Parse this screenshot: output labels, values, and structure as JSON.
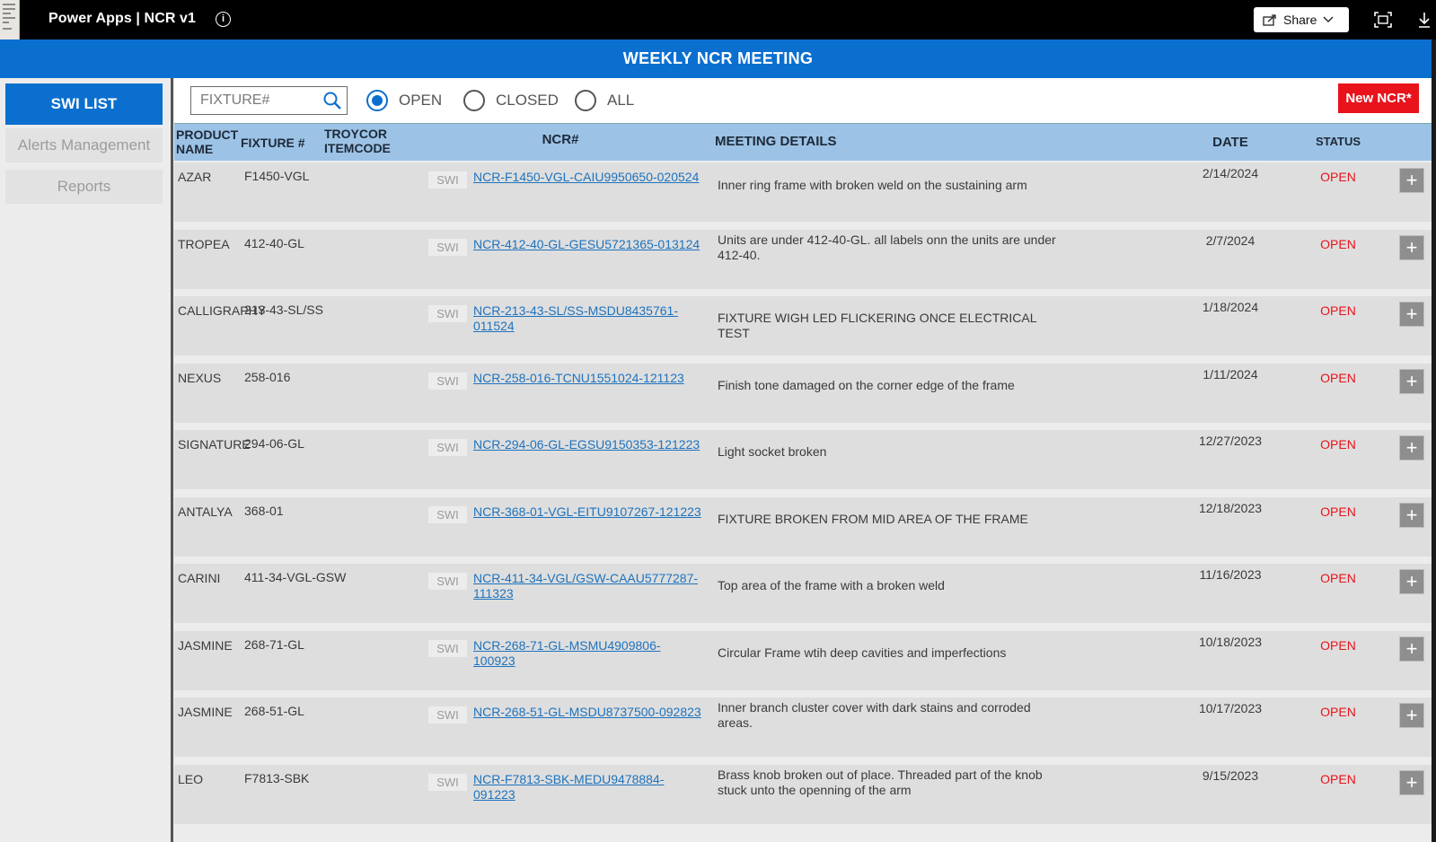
{
  "app": {
    "title": "Power Apps  |  NCR v1",
    "share_label": "Share"
  },
  "header": {
    "title": "WEEKLY NCR MEETING"
  },
  "sidebar": {
    "items": [
      {
        "label": "SWI LIST",
        "active": true
      },
      {
        "label": "Alerts Management",
        "active": false
      },
      {
        "label": "Reports",
        "active": false
      }
    ]
  },
  "filter": {
    "search_placeholder": "FIXTURE#",
    "options": [
      {
        "label": "OPEN",
        "selected": true
      },
      {
        "label": "CLOSED",
        "selected": false
      },
      {
        "label": "ALL",
        "selected": false
      }
    ],
    "new_button_label": "New NCR*"
  },
  "table": {
    "columns": {
      "product_line1": "PRODUCT",
      "product_line2": "NAME",
      "fixture": "FIXTURE #",
      "troycor_line1": "TROYCOR",
      "troycor_line2": "ITEMCODE",
      "ncr": "NCR#",
      "details": "MEETING DETAILS",
      "date": "DATE",
      "status": "STATUS"
    },
    "swi_label": "SWI",
    "add_label": "+",
    "rows": [
      {
        "product": "AZAR",
        "fixture": "F1450-VGL",
        "ncr": "NCR-F1450-VGL-CAIU9950650-020524",
        "details": "Inner ring frame with broken weld on the sustaining arm",
        "date": "2/14/2024",
        "status": "OPEN"
      },
      {
        "product": "TROPEA",
        "fixture": "412-40-GL",
        "ncr": "NCR-412-40-GL-GESU5721365-013124",
        "details": "Units are under 412-40-GL. all labels onn the units are under 412-40.",
        "date": "2/7/2024",
        "status": "OPEN"
      },
      {
        "product": "CALLIGRAPHY",
        "fixture": "213-43-SL/SS",
        "ncr": "NCR-213-43-SL/SS-MSDU8435761-011524",
        "details": "FIXTURE WIGH LED FLICKERING ONCE ELECTRICAL TEST",
        "date": "1/18/2024",
        "status": "OPEN"
      },
      {
        "product": "NEXUS",
        "fixture": "258-016",
        "ncr": "NCR-258-016-TCNU1551024-121123",
        "details": "Finish tone damaged on the corner edge of the frame",
        "date": "1/11/2024",
        "status": "OPEN"
      },
      {
        "product": "SIGNATURE",
        "fixture": "294-06-GL",
        "ncr": "NCR-294-06-GL-EGSU9150353-121223",
        "details": "Light socket broken",
        "date": "12/27/2023",
        "status": "OPEN"
      },
      {
        "product": "ANTALYA",
        "fixture": "368-01",
        "ncr": "NCR-368-01-VGL-EITU9107267-121223",
        "details": "FIXTURE BROKEN FROM MID AREA OF THE FRAME",
        "date": "12/18/2023",
        "status": "OPEN"
      },
      {
        "product": "CARINI",
        "fixture": "411-34-VGL-GSW",
        "ncr": "NCR-411-34-VGL/GSW-CAAU5777287-111323",
        "details": "Top area of the frame with a broken weld",
        "date": "11/16/2023",
        "status": "OPEN"
      },
      {
        "product": "JASMINE",
        "fixture": "268-71-GL",
        "ncr": "NCR-268-71-GL-MSMU4909806-100923",
        "details": "Circular Frame wtih deep cavities and imperfections",
        "date": "10/18/2023",
        "status": "OPEN"
      },
      {
        "product": "JASMINE",
        "fixture": "268-51-GL",
        "ncr": "NCR-268-51-GL-MSDU8737500-092823",
        "details": "Inner branch cluster cover with dark stains and corroded areas.",
        "date": "10/17/2023",
        "status": "OPEN"
      },
      {
        "product": "LEO",
        "fixture": "F7813-SBK",
        "ncr": "NCR-F7813-SBK-MEDU9478884-091223",
        "details": "Brass knob broken out of place. Threaded part of the knob stuck unto the openning of the arm",
        "date": "9/15/2023",
        "status": "OPEN"
      }
    ]
  }
}
